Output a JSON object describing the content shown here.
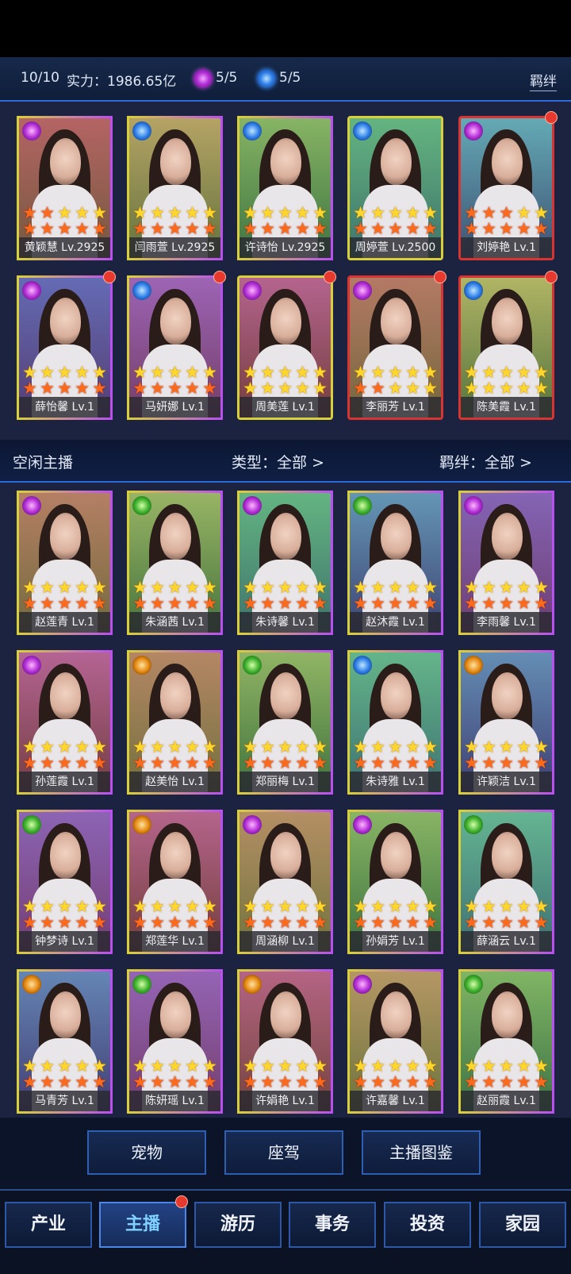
{
  "header": {
    "team_count": "10/10",
    "power_label": "实力：1986.65亿",
    "purple_gems": "5/5",
    "blue_gems": "5/5",
    "bond_link": "羁绊"
  },
  "team": [
    {
      "name": "黄颖慧 Lv.2925",
      "element": "purple",
      "stars": "ooyyyooooo",
      "frame": "gradyp",
      "dot": false
    },
    {
      "name": "闫雨萱 Lv.2925",
      "element": "blue",
      "stars": "yyyyyooooo",
      "frame": "gradyp",
      "dot": false
    },
    {
      "name": "许诗怡 Lv.2925",
      "element": "blue",
      "stars": "yyyyyooooo",
      "frame": "gradyp",
      "dot": false
    },
    {
      "name": "周婷萱 Lv.2500",
      "element": "blue",
      "stars": "yyyyyooooo",
      "frame": "yellow-b",
      "dot": false
    },
    {
      "name": "刘婷艳 Lv.1",
      "element": "purple",
      "stars": "oooyyooooo",
      "frame": "red-b",
      "dot": true
    },
    {
      "name": "薛怡馨 Lv.1",
      "element": "purple",
      "stars": "yyyyyooooo",
      "frame": "gradyp",
      "dot": true
    },
    {
      "name": "马妍娜 Lv.1",
      "element": "blue",
      "stars": "yyyyyooooo",
      "frame": "gradyp",
      "dot": true
    },
    {
      "name": "周美莲 Lv.1",
      "element": "purple",
      "stars": "yyyyyyyyyy",
      "frame": "yellow-b",
      "dot": true
    },
    {
      "name": "李丽芳 Lv.1",
      "element": "purple",
      "stars": "yyyyyooyyy",
      "frame": "red-b",
      "dot": true
    },
    {
      "name": "陈美霞 Lv.1",
      "element": "blue",
      "stars": "yyyyyyyyyy",
      "frame": "red-b",
      "dot": true
    }
  ],
  "idle": {
    "title": "空闲主播",
    "type_filter": "类型：全部 >",
    "bond_filter": "羁绊：全部 >"
  },
  "pool": [
    {
      "name": "赵莲青 Lv.1",
      "element": "purple",
      "stars": "yyyyyooooo",
      "frame": "gradyp"
    },
    {
      "name": "朱涵茜 Lv.1",
      "element": "green",
      "stars": "yyyyyooooo",
      "frame": "gradyp"
    },
    {
      "name": "朱诗馨 Lv.1",
      "element": "purple",
      "stars": "yyyyyooooo",
      "frame": "gradyp"
    },
    {
      "name": "赵沐霞 Lv.1",
      "element": "green",
      "stars": "yyyyyooooo",
      "frame": "gradyp"
    },
    {
      "name": "李雨馨 Lv.1",
      "element": "purple",
      "stars": "yyyyyooooo",
      "frame": "gradyp"
    },
    {
      "name": "孙莲霞 Lv.1",
      "element": "purple",
      "stars": "yyyyyooooo",
      "frame": "gradyp"
    },
    {
      "name": "赵美怡 Lv.1",
      "element": "orange",
      "stars": "yyyyyooooo",
      "frame": "gradyp"
    },
    {
      "name": "郑丽梅 Lv.1",
      "element": "green",
      "stars": "yyyyyooooo",
      "frame": "gradyp"
    },
    {
      "name": "朱诗雅 Lv.1",
      "element": "blue",
      "stars": "yyyyyooooo",
      "frame": "gradyp"
    },
    {
      "name": "许颖洁 Lv.1",
      "element": "orange",
      "stars": "yyyyyooooo",
      "frame": "gradyp"
    },
    {
      "name": "钟梦诗 Lv.1",
      "element": "green",
      "stars": "yyyyyooooo",
      "frame": "gradyp"
    },
    {
      "name": "郑莲华 Lv.1",
      "element": "orange",
      "stars": "yyyyyooooo",
      "frame": "gradyp"
    },
    {
      "name": "周涵柳 Lv.1",
      "element": "purple",
      "stars": "yyyyyooooo",
      "frame": "gradyp"
    },
    {
      "name": "孙娟芳 Lv.1",
      "element": "purple",
      "stars": "yyyyyooooo",
      "frame": "gradyp"
    },
    {
      "name": "薛涵云 Lv.1",
      "element": "green",
      "stars": "yyyyyooooo",
      "frame": "gradyp"
    },
    {
      "name": "马青芳 Lv.1",
      "element": "orange",
      "stars": "yyyyyooooo",
      "frame": "gradyp"
    },
    {
      "name": "陈妍瑶 Lv.1",
      "element": "green",
      "stars": "yyyyyooooo",
      "frame": "gradyp"
    },
    {
      "name": "许娟艳 Lv.1",
      "element": "orange",
      "stars": "yyyyyooooo",
      "frame": "gradyp"
    },
    {
      "name": "许嘉馨 Lv.1",
      "element": "purple",
      "stars": "yyyyyooooo",
      "frame": "gradyp"
    },
    {
      "name": "赵丽霞 Lv.1",
      "element": "green",
      "stars": "yyyyyooooo",
      "frame": "gradyp"
    }
  ],
  "sub_buttons": [
    "宠物",
    "座驾",
    "主播图鉴"
  ],
  "tabs": [
    "产业",
    "主播",
    "游历",
    "事务",
    "投资",
    "家园"
  ],
  "active_tab": "主播"
}
